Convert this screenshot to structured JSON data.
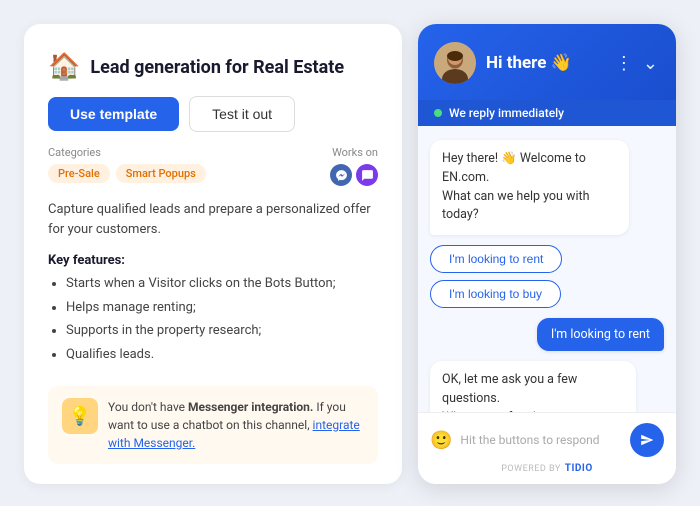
{
  "page": {
    "background": "#eef0f7"
  },
  "left": {
    "title": "Lead generation for Real Estate",
    "house_icon": "🏠",
    "btn_use_template": "Use template",
    "btn_test_it_out": "Test it out",
    "categories_label": "Categories",
    "tags": [
      "Pre-Sale",
      "Smart Popups"
    ],
    "works_on_label": "Works on",
    "description": "Capture qualified leads and prepare a personalized offer for your customers.",
    "key_features_title": "Key features:",
    "features": [
      "Starts when a Visitor clicks on the Bots Button;",
      "Helps manage renting;",
      "Supports in the property research;",
      "Qualifies leads."
    ],
    "banner_icon": "💡",
    "banner_text_1": "You don't have ",
    "banner_bold": "Messenger integration.",
    "banner_text_2": " If you want to use a chatbot on this channel, ",
    "banner_link": "integrate with Messenger.",
    "banner_link_url": "#"
  },
  "chat": {
    "header_title": "Hi there 👋",
    "avatar_alt": "Agent avatar",
    "status_text": "We reply immediately",
    "messages": [
      {
        "type": "bot",
        "text": "Hey there! 👋 Welcome to EN.com.\nWhat can we help you with today?"
      },
      {
        "type": "option",
        "text": "I'm looking to rent"
      },
      {
        "type": "option",
        "text": "I'm looking to buy"
      },
      {
        "type": "user",
        "text": "I'm looking to rent"
      },
      {
        "type": "bot",
        "text": "OK, let me ask you a few questions.\nWhat type of real estate are you looking for?"
      }
    ],
    "input_placeholder": "Hit the buttons to respond",
    "powered_by_label": "POWERED BY",
    "tidio_label": "TIDIO",
    "send_icon": "▶"
  }
}
